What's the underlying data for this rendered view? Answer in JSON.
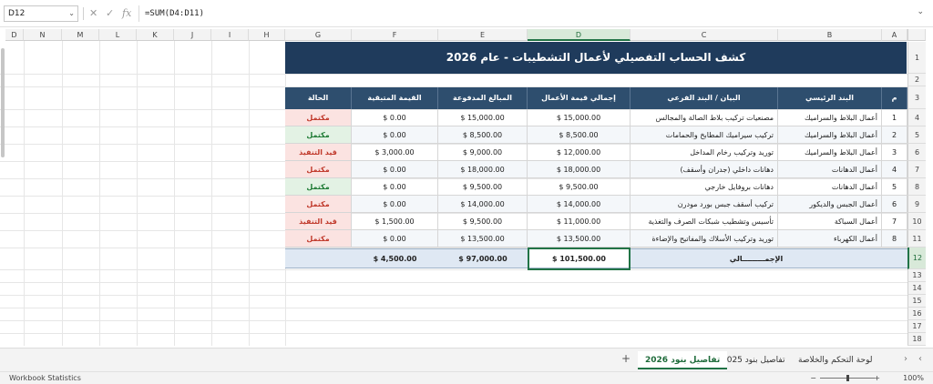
{
  "formula_bar": {
    "name_box": "D12",
    "cancel_icon": "✕",
    "confirm_icon": "✓",
    "fx_icon": "fx",
    "formula": "=SUM(D4:D11)"
  },
  "columns": [
    "D",
    "N",
    "M",
    "L",
    "K",
    "J",
    "I",
    "H",
    "G",
    "F",
    "E",
    "D",
    "C",
    "B",
    "A"
  ],
  "rows": [
    "1",
    "2",
    "3",
    "4",
    "5",
    "6",
    "7",
    "8",
    "9",
    "10",
    "11",
    "12",
    "13",
    "14",
    "15",
    "16",
    "17",
    "18"
  ],
  "title": "كشف الحساب التفصيلي لأعمال التشطيبات - عام 2026",
  "table": {
    "headers": {
      "no": "م",
      "main_item": "البند الرئيسي",
      "sub_item": "البيان / البند الفرعي",
      "total_value": "إجمالي قيمة الأعمال",
      "paid": "المبالغ المدفوعة",
      "remaining": "القيمة المتبقية",
      "status": "الحالة"
    },
    "rows": [
      {
        "no": "1",
        "main": "أعمال البلاط والسراميك",
        "sub": "مصنعيات تركيب بلاط الصالة والمجالس",
        "total": "$ 15,000.00",
        "paid": "$ 15,000.00",
        "remaining": "$ 0.00",
        "status": "مكتمل",
        "status_kind": "done-red"
      },
      {
        "no": "2",
        "main": "أعمال البلاط والسراميك",
        "sub": "تركيب سيراميك المطابخ والحمامات",
        "total": "$ 8,500.00",
        "paid": "$ 8,500.00",
        "remaining": "$ 0.00",
        "status": "مكتمل",
        "status_kind": "done-green"
      },
      {
        "no": "3",
        "main": "أعمال البلاط والسراميك",
        "sub": "توريد وتركيب رخام المداخل",
        "total": "$ 12,000.00",
        "paid": "$ 9,000.00",
        "remaining": "$ 3,000.00",
        "status": "قيد التنفيذ",
        "status_kind": "pending"
      },
      {
        "no": "4",
        "main": "أعمال الدهانات",
        "sub": "دهانات داخلي (جدران وأسقف)",
        "total": "$ 18,000.00",
        "paid": "$ 18,000.00",
        "remaining": "$ 0.00",
        "status": "مكتمل",
        "status_kind": "done-red"
      },
      {
        "no": "5",
        "main": "أعمال الدهانات",
        "sub": "دهانات بروفايل خارجي",
        "total": "$ 9,500.00",
        "paid": "$ 9,500.00",
        "remaining": "$ 0.00",
        "status": "مكتمل",
        "status_kind": "done-green"
      },
      {
        "no": "6",
        "main": "أعمال الجبس والديكور",
        "sub": "تركيب أسقف جبس بورد مودرن",
        "total": "$ 14,000.00",
        "paid": "$ 14,000.00",
        "remaining": "$ 0.00",
        "status": "مكتمل",
        "status_kind": "done-red"
      },
      {
        "no": "7",
        "main": "أعمال السباكة",
        "sub": "تأسيس وتشطيب شبكات الصرف والتغذية",
        "total": "$ 11,000.00",
        "paid": "$ 9,500.00",
        "remaining": "$ 1,500.00",
        "status": "قيد التنفيذ",
        "status_kind": "pending"
      },
      {
        "no": "8",
        "main": "أعمال الكهرباء",
        "sub": "توريد وتركيب الأسلاك والمفاتيح والإضاءة",
        "total": "$ 13,500.00",
        "paid": "$ 13,500.00",
        "remaining": "$ 0.00",
        "status": "مكتمل",
        "status_kind": "done-red"
      }
    ],
    "total": {
      "label": "الإجمـــــــــالي",
      "total": "$ 101,500.00",
      "paid": "$ 97,000.00",
      "remaining": "$ 4,500.00"
    }
  },
  "sheet_tabs": {
    "add": "+",
    "tabs": [
      "تفاصيل بنود 2026",
      "تفاصيل بنود 2025",
      "لوحة التحكم والخلاصة"
    ],
    "active": "تفاصيل بنود 2026",
    "prev": "‹",
    "next": "›"
  },
  "status_bar": {
    "left": "Workbook Statistics",
    "zoom": "100%",
    "zoom_minus": "−",
    "zoom_plus": "+"
  },
  "colors": {
    "title_bg": "#1f3b5c",
    "header_bg": "#2e4e6e",
    "accent": "#217346"
  }
}
